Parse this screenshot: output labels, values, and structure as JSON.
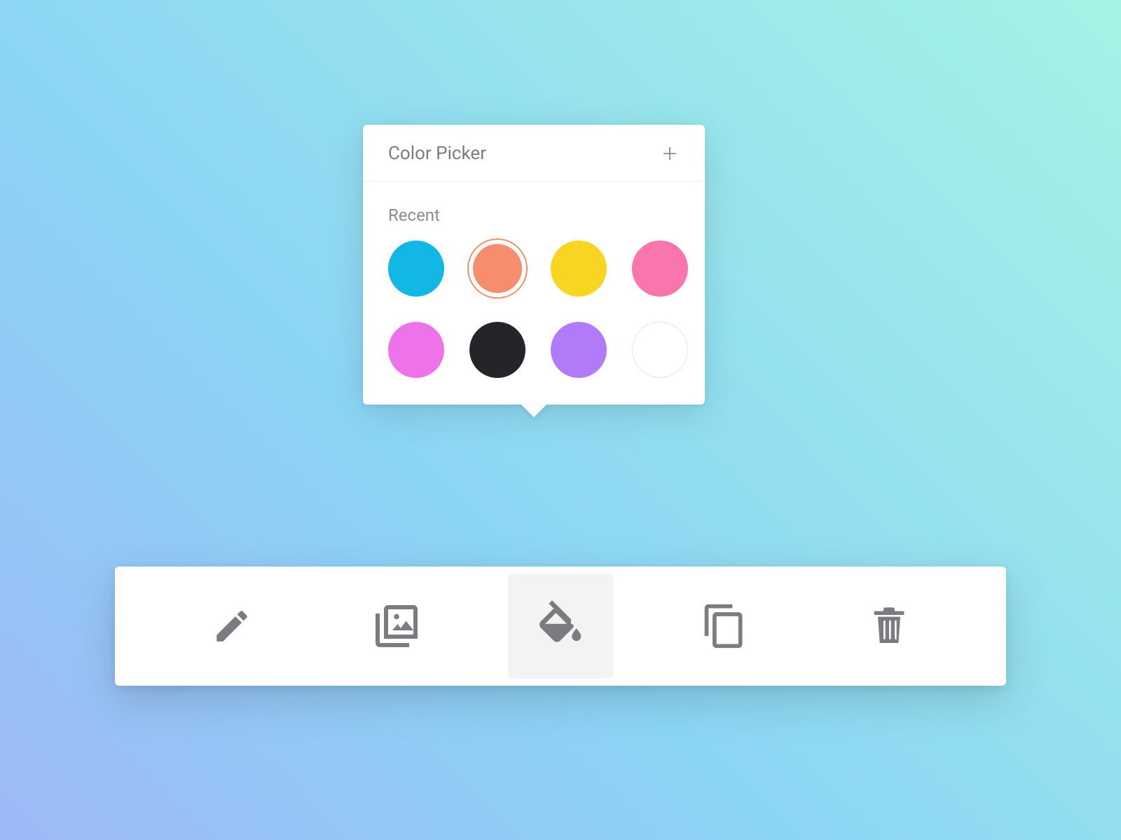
{
  "popover": {
    "title": "Color Picker",
    "section_label": "Recent",
    "swatches": [
      {
        "name": "cyan",
        "hex": "#13b7e6",
        "selected": false,
        "border": false
      },
      {
        "name": "coral",
        "hex": "#f68e6e",
        "selected": true,
        "border": false
      },
      {
        "name": "yellow",
        "hex": "#f8d520",
        "selected": false,
        "border": false
      },
      {
        "name": "pink",
        "hex": "#f875ad",
        "selected": false,
        "border": false
      },
      {
        "name": "magenta",
        "hex": "#ee72ea",
        "selected": false,
        "border": false
      },
      {
        "name": "black",
        "hex": "#242429",
        "selected": false,
        "border": false
      },
      {
        "name": "purple",
        "hex": "#b07af8",
        "selected": false,
        "border": false
      },
      {
        "name": "white",
        "hex": "#ffffff",
        "selected": false,
        "border": true
      }
    ]
  },
  "toolbar": {
    "items": [
      {
        "name": "edit",
        "icon": "pencil-icon",
        "active": false
      },
      {
        "name": "image",
        "icon": "image-stack-icon",
        "active": false
      },
      {
        "name": "fill",
        "icon": "paint-fill-icon",
        "active": true
      },
      {
        "name": "copy",
        "icon": "copy-icon",
        "active": false
      },
      {
        "name": "delete",
        "icon": "trash-icon",
        "active": false
      }
    ]
  },
  "colors": {
    "icon_gray": "#7b7b80",
    "ring_color": "#f68e6e"
  }
}
